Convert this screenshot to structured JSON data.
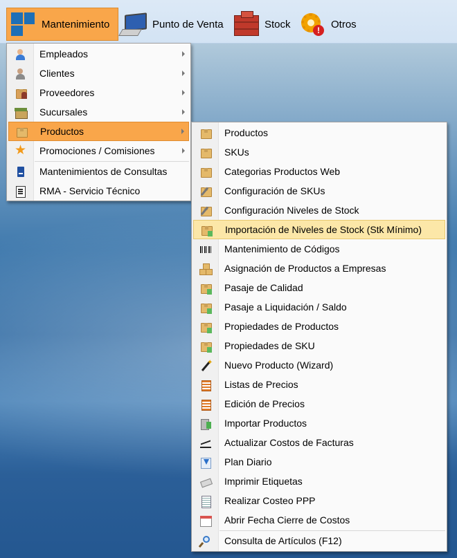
{
  "menubar": {
    "items": [
      {
        "label": "Mantenimiento",
        "icon": "tiles-icon"
      },
      {
        "label": "Punto de Venta",
        "icon": "computer-icon"
      },
      {
        "label": "Stock",
        "icon": "bricks-icon"
      },
      {
        "label": "Otros",
        "icon": "gear-warning-icon"
      }
    ]
  },
  "menu_main": {
    "items": [
      {
        "label": "Empleados",
        "icon": "employee-icon",
        "submenu": true
      },
      {
        "label": "Clientes",
        "icon": "client-icon",
        "submenu": true
      },
      {
        "label": "Proveedores",
        "icon": "supplier-icon",
        "submenu": true
      },
      {
        "label": "Sucursales",
        "icon": "branch-icon",
        "submenu": true
      },
      {
        "label": "Productos",
        "icon": "product-box-icon",
        "submenu": true,
        "highlighted": true
      },
      {
        "label": "Promociones / Comisiones",
        "icon": "star-icon",
        "submenu": true
      },
      {
        "label": "Mantenimientos de Consultas",
        "icon": "document-icon",
        "submenu": false
      },
      {
        "label": "RMA - Servicio Técnico",
        "icon": "rma-form-icon",
        "submenu": false
      }
    ]
  },
  "menu_productos": {
    "items": [
      {
        "label": "Productos",
        "icon": "product-box-icon"
      },
      {
        "label": "SKUs",
        "icon": "product-box-icon"
      },
      {
        "label": "Categorias Productos Web",
        "icon": "product-box-icon"
      },
      {
        "label": "Configuración de SKUs",
        "icon": "box-tools-icon"
      },
      {
        "label": "Configuración Niveles de Stock",
        "icon": "box-tools-icon"
      },
      {
        "label": "Importación de Niveles de Stock (Stk Mínimo)",
        "icon": "box-import-icon",
        "highlighted": true
      },
      {
        "label": "Mantenimiento de Códigos",
        "icon": "barcode-icon"
      },
      {
        "label": "Asignación de Productos a Empresas",
        "icon": "boxes-stack-icon"
      },
      {
        "label": "Pasaje de Calidad",
        "icon": "box-import-icon"
      },
      {
        "label": "Pasaje a Liquidación / Saldo",
        "icon": "box-import-icon"
      },
      {
        "label": "Propiedades de Productos",
        "icon": "box-import-icon"
      },
      {
        "label": "Propiedades de SKU",
        "icon": "box-import-icon"
      },
      {
        "label": "Nuevo Producto (Wizard)",
        "icon": "magic-wand-icon"
      },
      {
        "label": "Listas de Precios",
        "icon": "price-list-icon"
      },
      {
        "label": "Edición de Precios",
        "icon": "price-list-icon"
      },
      {
        "label": "Importar Productos",
        "icon": "import-products-icon"
      },
      {
        "label": "Actualizar Costos de Facturas",
        "icon": "chart-line-icon"
      },
      {
        "label": "Plan Diario",
        "icon": "download-arrow-icon"
      },
      {
        "label": "Imprimir Etiquetas",
        "icon": "label-print-icon"
      },
      {
        "label": "Realizar Costeo PPP",
        "icon": "report-icon"
      },
      {
        "label": "Abrir Fecha Cierre de Costos",
        "icon": "calendar-icon"
      },
      {
        "label": "Consulta de Artículos (F12)",
        "icon": "magnifier-icon"
      }
    ]
  }
}
